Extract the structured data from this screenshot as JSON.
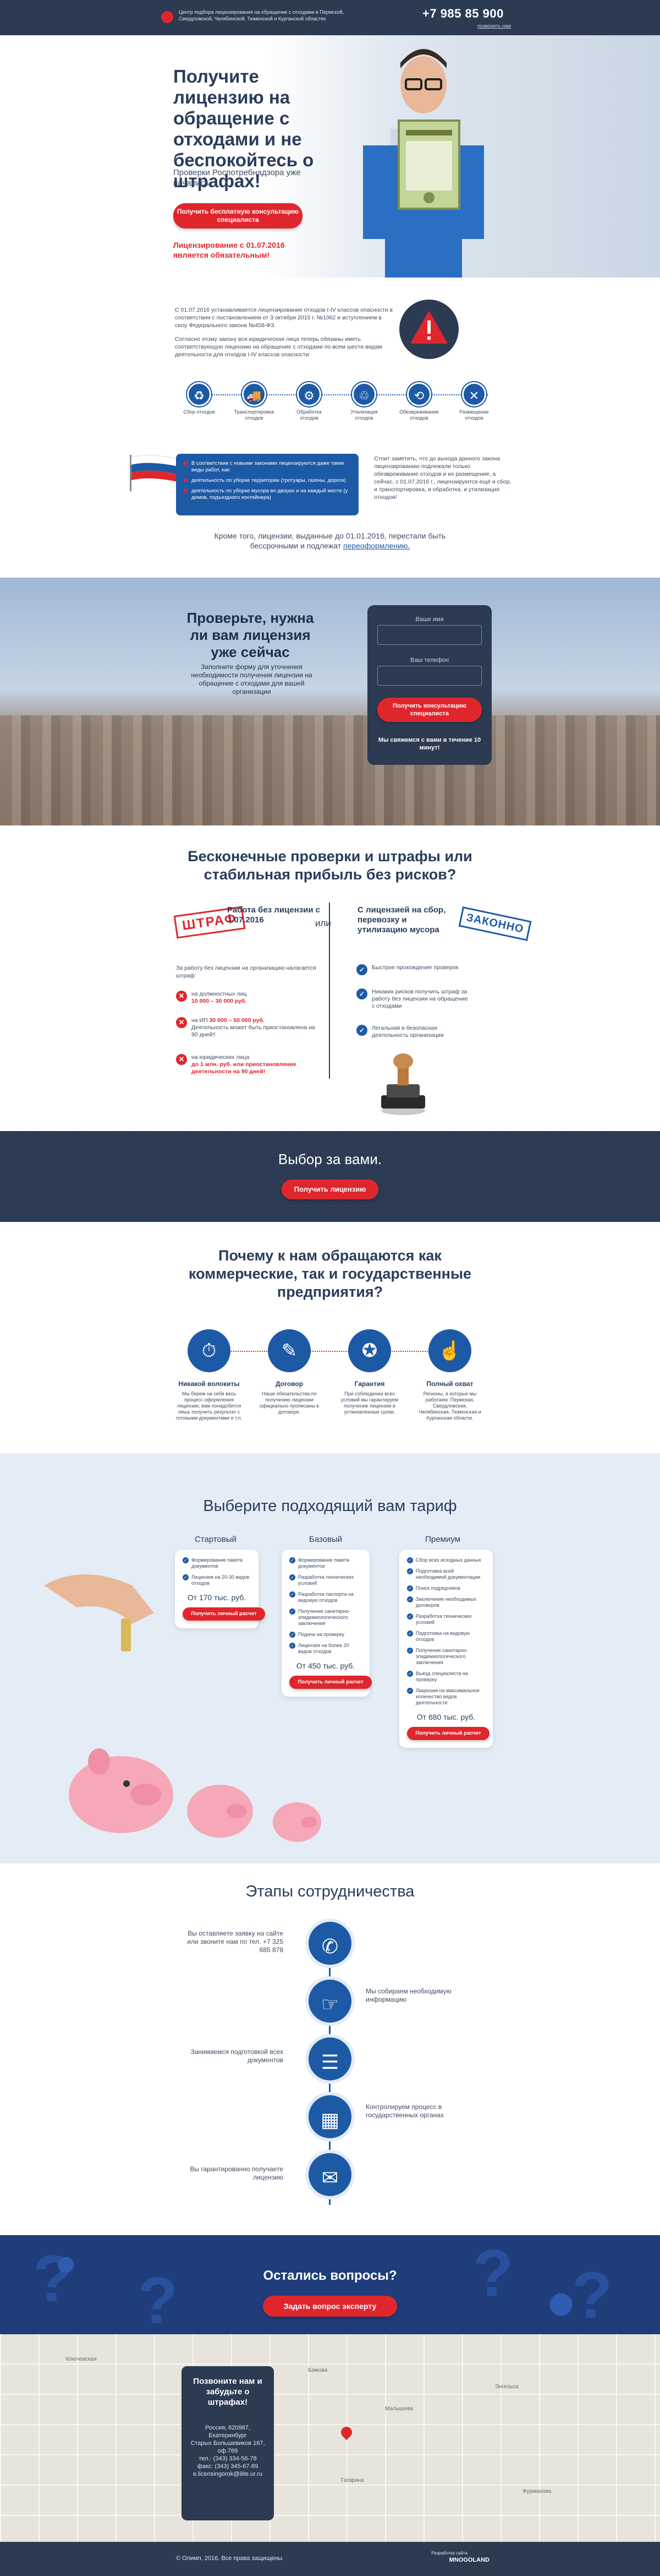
{
  "header": {
    "tagline": "Центр подбора лицензирования на обращение с отходами в Пермской, Свердловской, Челябинской, Тюменской и Курганской областях",
    "phone": "+7 985 85 900",
    "callback": "позвонить нам"
  },
  "hero": {
    "title": "Получите лицензию на обращение с отходами и не беспокойтесь о штрафах!",
    "subtitle": "Проверки Роспотребнадзора уже начались.",
    "cta": "Получить бесплатную консультацию специалиста",
    "note": "Лицензирование с 01.07.2016 является обязательным!"
  },
  "info": {
    "p1": "С 01.07.2016 устанавливается лицензирование отходов I-IV классов опасности в соответствии с постановлением от 3 октября 2015 г. №1062 и вступлением в силу Федерального закона №458-ФЗ.",
    "p2": "Согласно этому закону вся юридическая лица теперь обязаны иметь соответствующую лицензию на обращение с отходами по всем шести видам деятельности для отходов I-IV классов опасности:",
    "steps": [
      {
        "icon": "♻",
        "label": "Сбор отходов"
      },
      {
        "icon": "🚚",
        "label": "Транспортировка отходов"
      },
      {
        "icon": "⚙",
        "label": "Обработка отходов"
      },
      {
        "icon": "♲",
        "label": "Утилизация отходов"
      },
      {
        "icon": "⟲",
        "label": "Обезвреживание отходов"
      },
      {
        "icon": "✕",
        "label": "Размещение отходов"
      }
    ],
    "card_items": [
      "В соответствии с новыми законами лицензируются даже такие виды работ, как:",
      "деятельность по уборке территории (тротуары, газоны, дороги)",
      "деятельность по уборке мусора во дворах и на каждый месте (у домов, подъездного контейнера)"
    ],
    "p3": "Стоит заметить, что до выхода данного закона лицензированию подлежали только обезвреживание отходов и их размещение, а сейчас, с 01.07.2016 г., лицензируются ещё и сбор, и транспортировка, и обработка, и утилизация отходов!",
    "reform": "Кроме того, лицензии, выданные до 01.01.2016, перестали быть бессрочными и подлежат",
    "reform_link": "переоформлению."
  },
  "check": {
    "title": "Проверьте, нужна ли вам лицензия уже сейчас",
    "desc": "Заполните форму для уточнения необходимости получения лицензии на обращение с отходами для вашей организации",
    "name_label": "Ваше имя",
    "phone_label": "Ваш телефон",
    "cta": "Получить консультацию специалиста",
    "callback": "Мы свяжемся с вами в течение 10 минут!"
  },
  "risk": {
    "title": "Бесконечные проверки и штрафы или стабильная прибыль без рисков?",
    "stamp_fine": "ШТРАФ",
    "stamp_legal": "ЗАКОННО",
    "left_head": "Работа без лицензии с 1.07.2016",
    "or": "или",
    "right_head": "С лицензией на сбор, перевозку и утилизацию мусора",
    "left_intro": "За работу без лицензии на организацию налагается штраф:",
    "left_items": [
      {
        "pre": "на должностных лиц",
        "hl": "10 000 – 30 000 руб.",
        "post": ""
      },
      {
        "pre": "на ИП",
        "hl": "30 000 – 50 000 руб.",
        "post": "Деятельность может быть приостановлена на 90 дней!!"
      },
      {
        "pre": "на юридических лица",
        "hl": "до 1 млн. руб. или приостановление деятельности на 90 дней!",
        "post": ""
      }
    ],
    "right_items": [
      "Быстрое прохождение проверок",
      "Никаких рисков получить штраф за работу без лицензии на обращение с отходами",
      "Легальная и безопасная деятельность организации"
    ]
  },
  "choose": {
    "title": "Выбор за вами.",
    "cta": "Получить лицензию"
  },
  "why": {
    "title": "Почему к нам обращаются как коммерческие, так и государственные предприятия?",
    "items": [
      {
        "icon": "⏱",
        "title": "Никакой волокиты",
        "desc": "Мы берем на себя весь процесс оформления лицензии, вам понадобится лишь получить результат с готовыми документами и т.п."
      },
      {
        "icon": "✎",
        "title": "Договор",
        "desc": "Наши обязательства по получению лицензии официально прописаны в договоре."
      },
      {
        "icon": "✪",
        "title": "Гарантия",
        "desc": "При соблюдении всех условий мы гарантируем получение лицензии в установленные сроки."
      },
      {
        "icon": "☝",
        "title": "Полный охват",
        "desc": "Регионы, в которых мы работаем: Пермская, Свердловская, Челябинская, Тюменская и Курганская области."
      }
    ]
  },
  "tariffs": {
    "title": "Выберите подходящий вам тариф",
    "plans": [
      {
        "name": "Стартовый",
        "items": [
          "Формирование пакета документов",
          "Лицензия на 20-30 видов отходов"
        ],
        "price": "От 170 тыс. руб.",
        "cta": "Получить личный расчет"
      },
      {
        "name": "Базовый",
        "items": [
          "Формирование пакета документов",
          "Разработка технических условий",
          "Разработка паспорта на видовую отходов",
          "Получение санитарно-эпидемиологического заключения",
          "Подача на проверку",
          "Лицензия на более 20 видов отходов"
        ],
        "price": "От 450 тыс. руб.",
        "cta": "Получить личный расчет"
      },
      {
        "name": "Премиум",
        "items": [
          "Сбор всех исходных данных",
          "Подготовка всей необходимой документации",
          "Поиск подрядчиков",
          "Заключение необходимых договоров",
          "Разработка технических условий",
          "Подготовка на видовую отходов",
          "Получение санитарно-эпидемиологического заключения",
          "Выезд специалиста на проверку",
          "Лицензия на максимальное количество видов деятельности"
        ],
        "price": "От 680 тыс. руб.",
        "cta": "Получить личный расчет"
      }
    ]
  },
  "stages": {
    "title": "Этапы сотрудничества",
    "items": [
      {
        "icon": "✆",
        "side": "l",
        "text": "Вы оставляете заявку на сайте или звоните нам по тел. +7 325 685 878"
      },
      {
        "icon": "☞",
        "side": "r",
        "text": "Мы собираем необходимую информацию"
      },
      {
        "icon": "☰",
        "side": "l",
        "text": "Занимаемся подготовкой всех документов"
      },
      {
        "icon": "▦",
        "side": "r",
        "text": "Контролируем процесс в государственных органах"
      },
      {
        "icon": "✉",
        "side": "l",
        "text": "Вы гарантированно получаете лицензию"
      }
    ]
  },
  "questions": {
    "title": "Остались вопросы?",
    "cta": "Задать вопрос эксперту"
  },
  "contact": {
    "title": "Позвоните нам и забудьте о штрафах!",
    "address": "Россия, 620987, Екатеринбург\nСтарых Большевиков 167, оф.769\nтел.: (343) 334-56-78\nфакс: (343) 345-67-89\ne.licensingorok@ilite.ur.ru",
    "map_labels": [
      "Ключевская",
      "Бажова",
      "Малышева",
      "Энгельса",
      "Гагарина",
      "Фурманова"
    ]
  },
  "footer": {
    "copyright": "© Олимп, 2016. Все права защищены.",
    "dev": "Разработка сайта",
    "brand": "MNOGOLAND"
  },
  "colors": {
    "navy": "#2c3a52",
    "accent": "#e0262d",
    "blue": "#1d5aa6",
    "bg_light": "#e4ecf6"
  }
}
